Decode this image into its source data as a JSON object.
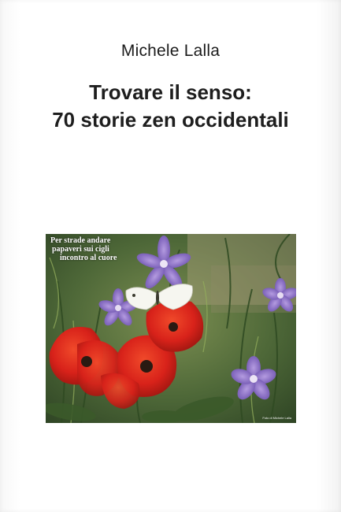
{
  "book": {
    "author": "Michele Lalla",
    "title_line1": "Trovare il senso:",
    "title_line2": "70 storie zen occidentali"
  },
  "cover_photo": {
    "poem_line1": "Per strade andare",
    "poem_line2": "papaveri sui cigli",
    "poem_line3": "incontro al cuore",
    "credit": "Foto di Michele Lalla"
  },
  "colors": {
    "poppy": "#d6231a",
    "mallow": "#8b6fc4",
    "foliage": "#4f6a3a",
    "butterfly": "#f4f4ee"
  }
}
